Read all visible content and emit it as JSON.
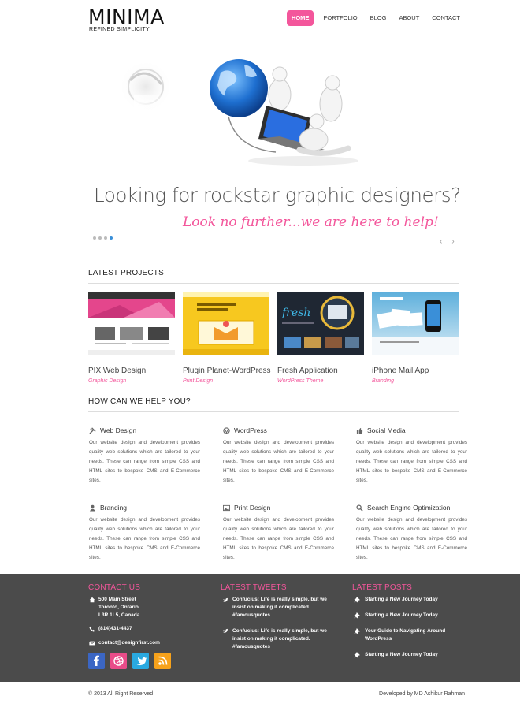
{
  "header": {
    "logo": "MINIMA",
    "tagline": "REFINED SIMPLICITY",
    "nav": [
      "HOME",
      "PORTFOLIO",
      "BLOG",
      "ABOUT",
      "CONTACT"
    ],
    "active_nav": "HOME"
  },
  "hero": {
    "headline": "Looking for rockstar graphic designers?",
    "subline": "Look no further...we are here to help!",
    "slide_count": 4,
    "active_slide": 4,
    "prev": "‹",
    "next": "›"
  },
  "projects": {
    "title": "LATEST PROJECTS",
    "items": [
      {
        "title": "PIX Web Design",
        "category": "Graphic Design"
      },
      {
        "title": "Plugin Planet-WordPress",
        "category": "Print Design"
      },
      {
        "title": "Fresh Application",
        "category": "WordPress Theme"
      },
      {
        "title": "iPhone Mail App",
        "category": "Branding"
      }
    ]
  },
  "services": {
    "title": "HOW CAN WE HELP YOU?",
    "body": "Our website design and development provides quality web solutions which are tailored to your needs. These can range from simple CSS and HTML sites to bespoke CMS and E-Commerce sites.",
    "items": [
      {
        "title": "Web Design",
        "icon": "tools-icon"
      },
      {
        "title": "WordPress",
        "icon": "wordpress-icon"
      },
      {
        "title": "Social Media",
        "icon": "thumbs-up-icon"
      },
      {
        "title": "Branding",
        "icon": "user-icon"
      },
      {
        "title": "Print Design",
        "icon": "image-icon"
      },
      {
        "title": "Search Engine Optimization",
        "icon": "search-icon"
      }
    ]
  },
  "footer": {
    "contact": {
      "title": "CONTACT US",
      "address": [
        "500 Main Street",
        "Toronto, Ontario",
        "L3R 1L5, Canada"
      ],
      "phone": "(814)431-4437",
      "email": "contact@designfirst.com"
    },
    "tweets": {
      "title": "LATEST TWEETS",
      "items": [
        [
          "Confucius: Life is really simple, but we",
          "insist on making it complicated.",
          "#famousquotes"
        ],
        [
          "Confucius: Life is really simple, but we",
          "insist on making it complicated.",
          "#famousquotes"
        ]
      ]
    },
    "posts": {
      "title": "LATEST POSTS",
      "items": [
        [
          "Starting a New Journey Today"
        ],
        [
          "Starting a New Journey Today"
        ],
        [
          "Your Guide to Navigating Around",
          "WordPress"
        ],
        [
          "Starting a New Journey Today"
        ]
      ]
    },
    "social": [
      {
        "name": "facebook",
        "glyph": "f",
        "color": "#3b66c4"
      },
      {
        "name": "dribbble",
        "glyph": "◎",
        "color": "#ea4c89"
      },
      {
        "name": "twitter",
        "glyph": "t",
        "color": "#2aa9e0"
      },
      {
        "name": "rss",
        "glyph": "◗",
        "color": "#f7a21b"
      }
    ],
    "copyright": "© 2013 All Right Reserved",
    "developed_by": "Developed by MD Ashikur Rahman"
  },
  "colors": {
    "accent": "#f3569b",
    "footer_bg": "#4b4b4b"
  }
}
